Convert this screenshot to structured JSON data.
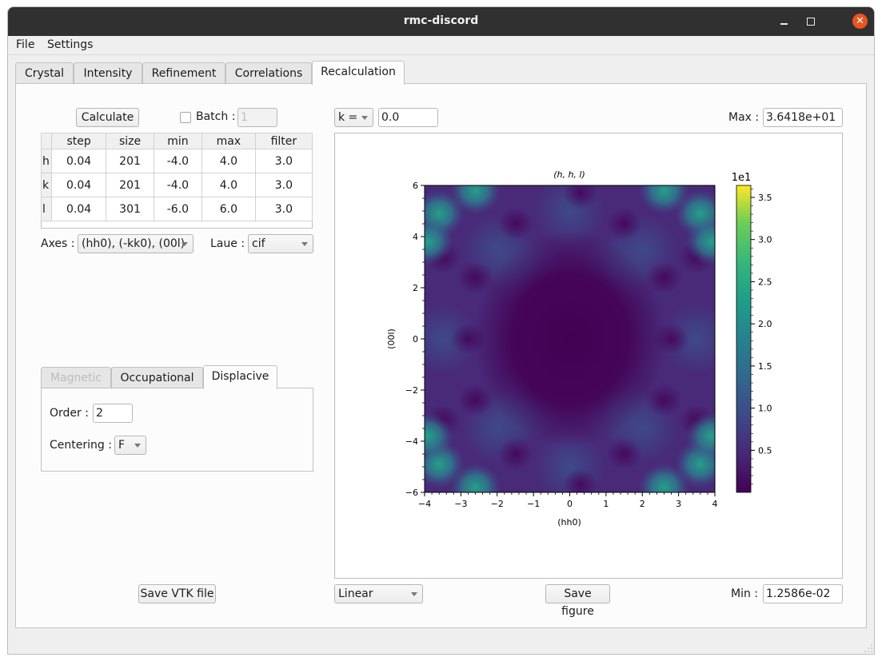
{
  "window": {
    "title": "rmc-discord"
  },
  "menubar": {
    "items": [
      "File",
      "Settings"
    ]
  },
  "tabs": [
    {
      "label": "Crystal",
      "active": false
    },
    {
      "label": "Intensity",
      "active": false
    },
    {
      "label": "Refinement",
      "active": false
    },
    {
      "label": "Correlations",
      "active": false
    },
    {
      "label": "Recalculation",
      "active": true
    }
  ],
  "left": {
    "calculate_label": "Calculate",
    "batch_label": "Batch :",
    "batch_checked": false,
    "batch_value": "1",
    "grid": {
      "columns": [
        "step",
        "size",
        "min",
        "max",
        "filter"
      ],
      "rows": [
        {
          "axis": "h",
          "cells": [
            "0.04",
            "201",
            "-4.0",
            "4.0",
            "3.0"
          ]
        },
        {
          "axis": "k",
          "cells": [
            "0.04",
            "201",
            "-4.0",
            "4.0",
            "3.0"
          ]
        },
        {
          "axis": "l",
          "cells": [
            "0.04",
            "301",
            "-6.0",
            "6.0",
            "3.0"
          ]
        }
      ]
    },
    "axes_label": "Axes :",
    "axes_value": "(hh0), (-kk0), (00l)",
    "laue_label": "Laue :",
    "laue_value": "cif",
    "subtabs": [
      {
        "label": "Magnetic",
        "enabled": false,
        "active": false
      },
      {
        "label": "Occupational",
        "enabled": true,
        "active": false
      },
      {
        "label": "Displacive",
        "enabled": true,
        "active": true
      }
    ],
    "order_label": "Order :",
    "order_value": "2",
    "centering_label": "Centering :",
    "centering_value": "F",
    "save_vtk_label": "Save VTK file"
  },
  "right": {
    "slice_axis": "k =",
    "slice_value": "0.0",
    "max_label": "Max :",
    "max_value": "3.6418e+01",
    "min_label": "Min :",
    "min_value": "1.2586e-02",
    "scale_value": "Linear",
    "save_figure_label": "Save figure"
  },
  "chart_data": {
    "type": "heatmap",
    "title": "(h, h, l)",
    "xlabel": "(hh0)",
    "ylabel": "(00l)",
    "xlim": [
      -4,
      4
    ],
    "ylim": [
      -6,
      6
    ],
    "xticks": [
      "−4",
      "−3",
      "−2",
      "−1",
      "0",
      "1",
      "2",
      "3",
      "4"
    ],
    "yticks": [
      "−6",
      "−4",
      "−2",
      "0",
      "2",
      "4",
      "6"
    ],
    "colormap": "viridis",
    "colorbar": {
      "label": "1e1",
      "range": [
        0.0012586,
        3.6418
      ],
      "ticks": [
        "0.5",
        "1.0",
        "1.5",
        "2.0",
        "2.5",
        "3.0",
        "3.5"
      ]
    },
    "description": "Diffuse intensity map: low intensity dark center around origin, brighter teal spots near corners (h≈±3.5, l≈±5)"
  }
}
